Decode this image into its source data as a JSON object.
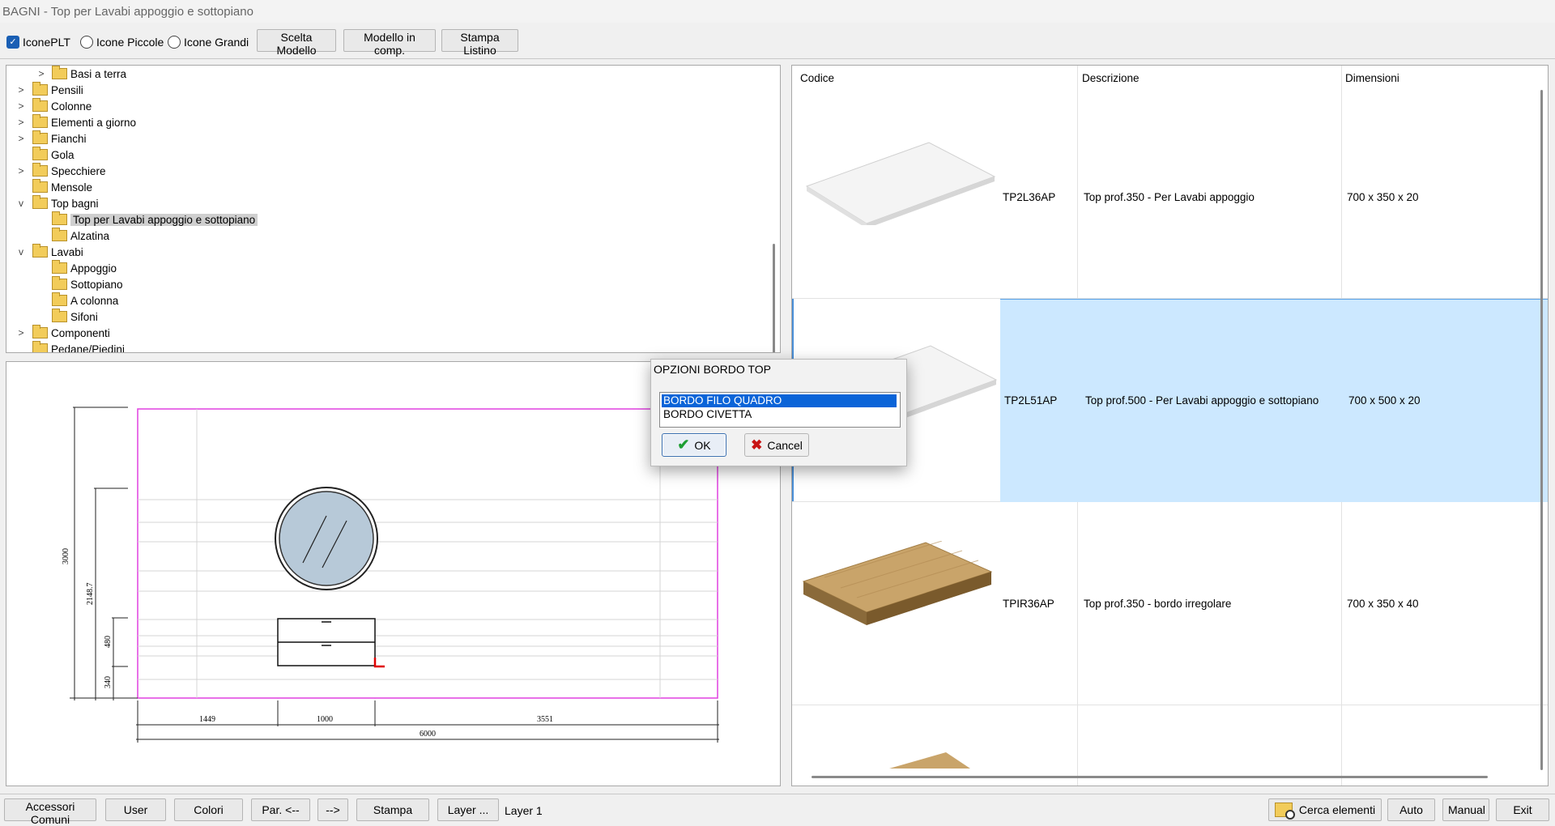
{
  "window": {
    "title": "BAGNI - Top per Lavabi appoggio e sottopiano"
  },
  "toolbar": {
    "icone_plt": "IconePLT",
    "icone_piccole": "Icone Piccole",
    "icone_grandi": "Icone Grandi",
    "scelta_modello": "Scelta Modello",
    "modello_in_comp": "Modello in comp.",
    "stampa_listino": "Stampa Listino"
  },
  "tree": {
    "items": [
      {
        "label": "Basi a terra"
      },
      {
        "label": "Pensili"
      },
      {
        "label": "Colonne"
      },
      {
        "label": "Elementi a giorno"
      },
      {
        "label": "Fianchi"
      },
      {
        "label": "Gola"
      },
      {
        "label": "Specchiere"
      },
      {
        "label": "Mensole"
      },
      {
        "label": "Top bagni"
      },
      {
        "label": "Top per Lavabi appoggio e sottopiano"
      },
      {
        "label": "Alzatina"
      },
      {
        "label": "Lavabi"
      },
      {
        "label": "Appoggio"
      },
      {
        "label": "Sottopiano"
      },
      {
        "label": "A colonna"
      },
      {
        "label": "Sifoni"
      },
      {
        "label": "Componenti"
      },
      {
        "label": "Pedane/Piedini"
      }
    ]
  },
  "drawing": {
    "dims": {
      "height_total": "3000",
      "height_mirror": "2148.7",
      "h480": "480",
      "h340": "340",
      "w1449": "1449",
      "w1000": "1000",
      "w3551": "3551",
      "w6000": "6000"
    },
    "colors": {
      "room_outline": "#e040e0",
      "marker": "#e00000"
    }
  },
  "grid": {
    "headers": {
      "codice": "Codice",
      "descrizione": "Descrizione",
      "dimensioni": "Dimensioni"
    },
    "rows": [
      {
        "code": "TP2L36AP",
        "desc": "Top prof.350 - Per Lavabi appoggio",
        "dim": "700 x 350 x 20",
        "selected": false
      },
      {
        "code": "TP2L51AP",
        "desc": "Top prof.500 - Per Lavabi appoggio e sottopiano",
        "dim": "700 x 500 x 20",
        "selected": true
      },
      {
        "code": "TPIR36AP",
        "desc": "Top prof.350 - bordo irregolare",
        "dim": "700 x 350 x 40",
        "selected": false
      }
    ],
    "selection_color": "#cce8ff"
  },
  "dialog": {
    "title": "OPZIONI BORDO TOP",
    "options": [
      "BORDO FILO QUADRO",
      "BORDO CIVETTA"
    ],
    "ok": "OK",
    "cancel": "Cancel"
  },
  "statusbar": {
    "accessori_comuni": "Accessori Comuni",
    "user": "User",
    "colori": "Colori",
    "par_prev": "Par. <--",
    "next": "-->",
    "stampa": "Stampa",
    "layer_btn": "Layer ...",
    "layer_label": "Layer 1",
    "cerca_elementi": "Cerca elementi",
    "auto": "Auto",
    "manual": "Manual",
    "exit": "Exit"
  }
}
